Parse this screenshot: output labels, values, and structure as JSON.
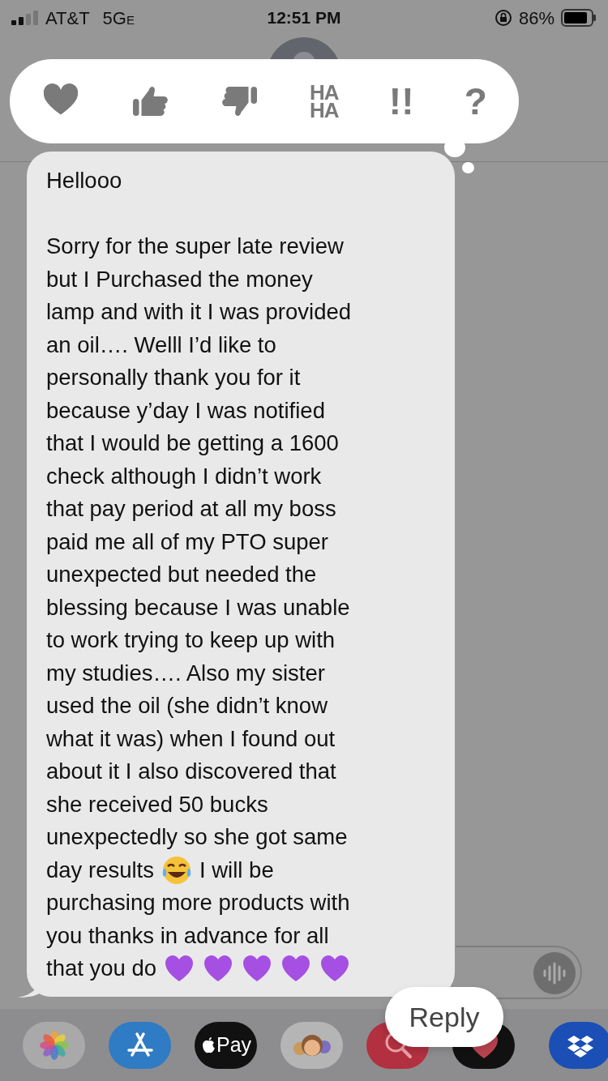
{
  "status_bar": {
    "carrier": "AT&T",
    "network": "5G",
    "network_suffix": "E",
    "time": "12:51 PM",
    "battery": "86%"
  },
  "reactions": [
    {
      "kind": "heart"
    },
    {
      "kind": "like"
    },
    {
      "kind": "dislike"
    },
    {
      "kind": "haha",
      "lines": [
        "HA",
        "HA"
      ]
    },
    {
      "kind": "glyph",
      "text": "!!"
    },
    {
      "kind": "glyph",
      "text": "?"
    }
  ],
  "message": {
    "paragraphs": [
      [
        [
          {
            "kind": "text",
            "text": "Hellooo"
          }
        ]
      ],
      [
        [
          {
            "kind": "text",
            "text": "Sorry for the super late review"
          }
        ],
        [
          {
            "kind": "text",
            "text": "but I Purchased the money"
          }
        ],
        [
          {
            "kind": "text",
            "text": "lamp and with it I was provided"
          }
        ],
        [
          {
            "kind": "text",
            "text": "an oil…. Welll I’d like to"
          }
        ],
        [
          {
            "kind": "text",
            "text": "personally thank you for it"
          }
        ],
        [
          {
            "kind": "text",
            "text": "because y’day I was notified"
          }
        ],
        [
          {
            "kind": "text",
            "text": "that I would be getting a 1600"
          }
        ],
        [
          {
            "kind": "text",
            "text": "check although I didn’t work"
          }
        ],
        [
          {
            "kind": "text",
            "text": "that pay period at all my boss"
          }
        ],
        [
          {
            "kind": "text",
            "text": "paid me all of my PTO super"
          }
        ],
        [
          {
            "kind": "text",
            "text": "unexpected but needed the"
          }
        ],
        [
          {
            "kind": "text",
            "text": "blessing because I was unable"
          }
        ],
        [
          {
            "kind": "text",
            "text": "to work trying to keep up with"
          }
        ],
        [
          {
            "kind": "text",
            "text": "my studies…. Also my sister"
          }
        ],
        [
          {
            "kind": "text",
            "text": "used the oil (she didn’t know"
          }
        ],
        [
          {
            "kind": "text",
            "text": "what it was) when I found out"
          }
        ],
        [
          {
            "kind": "text",
            "text": "about it I also discovered that"
          }
        ],
        [
          {
            "kind": "text",
            "text": "she received 50 bucks"
          }
        ],
        [
          {
            "kind": "text",
            "text": "unexpectedly so she got same"
          }
        ],
        [
          {
            "kind": "text",
            "text": "day results"
          },
          {
            "kind": "laugh"
          },
          {
            "kind": "text",
            "text": "I will be"
          }
        ],
        [
          {
            "kind": "text",
            "text": "purchasing more products with"
          }
        ],
        [
          {
            "kind": "text",
            "text": "you thanks in advance for all"
          }
        ],
        [
          {
            "kind": "text",
            "text": "that you do"
          },
          {
            "kind": "heart"
          },
          {
            "kind": "heart"
          },
          {
            "kind": "heart"
          },
          {
            "kind": "heart"
          },
          {
            "kind": "heart"
          }
        ]
      ]
    ]
  },
  "reply_button": "Reply",
  "dock": [
    {
      "kind": "photos"
    },
    {
      "kind": "appstore"
    },
    {
      "kind": "pay",
      "label": "Pay"
    },
    {
      "kind": "memoji"
    },
    {
      "kind": "search"
    },
    {
      "kind": "heartapp"
    },
    {
      "kind": "divider"
    },
    {
      "kind": "dropbox"
    }
  ]
}
